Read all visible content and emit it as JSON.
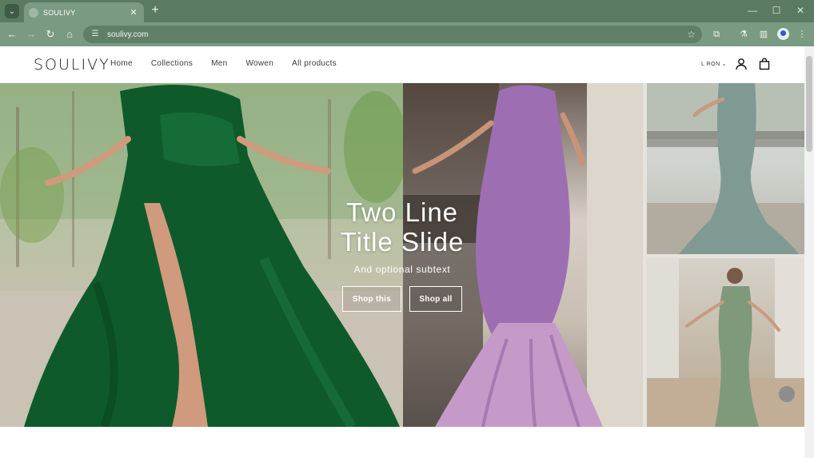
{
  "browser": {
    "tab_title": "SOULIVY",
    "url": "soulivy.com",
    "icons": {
      "tab_search": "chevron-down-icon",
      "back": "back-arrow-icon",
      "forward": "forward-arrow-icon",
      "reload": "reload-icon",
      "home": "home-icon",
      "bookmark": "star-icon",
      "extensions": "puzzle-icon"
    }
  },
  "site": {
    "logo": "SOULIVY",
    "nav": [
      "Home",
      "Collections",
      "Men",
      "Wowen",
      "All products"
    ],
    "currency": "L RON"
  },
  "hero": {
    "title_line1": "Two Line",
    "title_line2": "Title Slide",
    "subtitle": "And optional subtext",
    "button_primary": "Shop this",
    "button_secondary": "Shop all"
  },
  "colors": {
    "chrome_bg": "#5a7a62",
    "toolbar_bg": "#7b9a82",
    "page_bg": "#ffffff",
    "dress_green": "#0f5a2a",
    "dress_purple": "#9d6fb2",
    "dress_sage": "#7e9a93"
  }
}
